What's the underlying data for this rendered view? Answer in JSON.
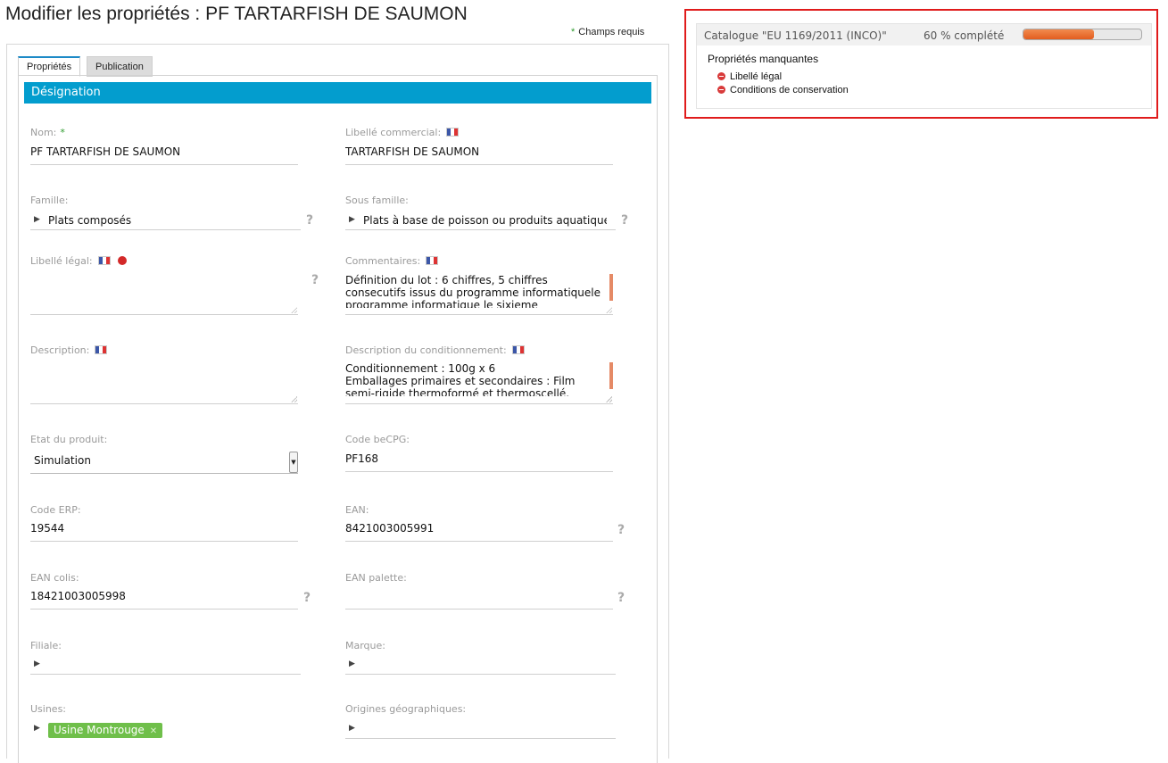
{
  "page": {
    "title": "Modifier les propriétés : PF TARTARFISH DE SAUMON",
    "required_note": "Champs requis",
    "required_star": "*"
  },
  "tabs": [
    {
      "label": "Propriétés",
      "active": true
    },
    {
      "label": "Publication",
      "active": false
    }
  ],
  "section": {
    "title": "Désignation"
  },
  "fields": {
    "nom": {
      "label": "Nom:",
      "value": "PF TARTARFISH DE SAUMON"
    },
    "libelle_commercial": {
      "label": "Libellé commercial:",
      "value": "TARTARFISH DE SAUMON"
    },
    "famille": {
      "label": "Famille:",
      "value": "Plats composés"
    },
    "sous_famille": {
      "label": "Sous famille:",
      "value": "Plats à base de poisson ou produits aquatiques"
    },
    "libelle_legal": {
      "label": "Libellé légal:",
      "value": ""
    },
    "commentaires": {
      "label": "Commentaires:",
      "lines": [
        "Définition du lot : 6 chiffres, 5 chiffres",
        "consecutifs issus du programme informatiquele",
        "programme informatique le sixieme"
      ]
    },
    "description": {
      "label": "Description:",
      "value": ""
    },
    "description_conditionnement": {
      "label": "Description du conditionnement:",
      "lines": [
        "Conditionnement : 100g x 6",
        "Emballages primaires et secondaires : Film",
        "semi-rigide thermoformé et thermoscellé."
      ]
    },
    "etat_produit": {
      "label": "Etat du produit:",
      "value": "Simulation"
    },
    "code_becpg": {
      "label": "Code beCPG:",
      "value": "PF168"
    },
    "code_erp": {
      "label": "Code ERP:",
      "value": "19544"
    },
    "ean": {
      "label": "EAN:",
      "value": "8421003005991"
    },
    "ean_colis": {
      "label": "EAN colis:",
      "value": "18421003005998"
    },
    "ean_palette": {
      "label": "EAN palette:",
      "value": ""
    },
    "filiale": {
      "label": "Filiale:",
      "value": ""
    },
    "marque": {
      "label": "Marque:",
      "value": ""
    },
    "usines": {
      "label": "Usines:",
      "tag": "Usine Montrouge"
    },
    "origines": {
      "label": "Origines géographiques:",
      "value": ""
    }
  },
  "help_glyph": "?",
  "catalog": {
    "title": "Catalogue \"EU 1169/2011 (INCO)\"",
    "completion_label": "60 % complété",
    "completion_fraction": 0.6,
    "missing_title": "Propriétés manquantes",
    "missing_items": [
      "Libellé légal",
      "Conditions de conservation"
    ],
    "accent_color": "#e25d1f",
    "highlight_border": "#e01b1b"
  },
  "colors": {
    "section_header": "#039dce",
    "required_star": "#2e9b2e",
    "tag_green": "#6fbf4a"
  },
  "icons": {
    "flag": "french-flag-icon",
    "expand": "triangle-right-icon",
    "help": "question-mark-icon",
    "missing": "minus-circle-icon"
  }
}
